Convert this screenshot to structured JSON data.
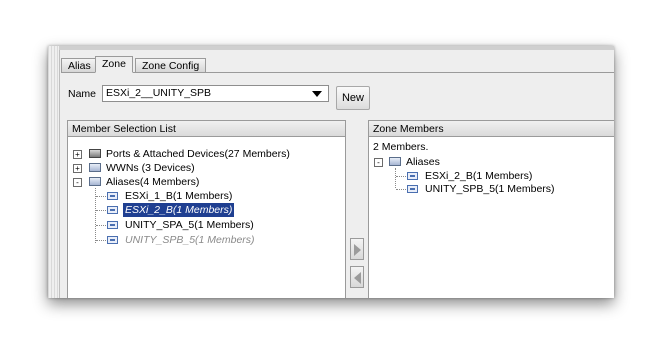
{
  "tabs": [
    {
      "label": "Alias",
      "active": false
    },
    {
      "label": "Zone",
      "active": true
    },
    {
      "label": "Zone Config",
      "active": false
    }
  ],
  "name_field": {
    "label": "Name",
    "value": "ESXi_2__UNITY_SPB"
  },
  "new_button": "New",
  "member_selection": {
    "title": "Member Selection List",
    "nodes": [
      {
        "label": "Ports & Attached Devices(27 Members)",
        "icon": "port-icon",
        "expander": "+"
      },
      {
        "label": "WWNs (3 Devices)",
        "icon": "wwn-icon",
        "expander": "+"
      },
      {
        "label": "Aliases(4 Members)",
        "icon": "folder-icon",
        "expander": "-"
      }
    ],
    "aliases": [
      {
        "label": "ESXi_1_B(1 Members)",
        "state": "normal"
      },
      {
        "label": "ESXi_2_B(1 Members)",
        "state": "selected"
      },
      {
        "label": "UNITY_SPA_5(1 Members)",
        "state": "normal"
      },
      {
        "label": "UNITY_SPB_5(1 Members)",
        "state": "disabled"
      }
    ]
  },
  "zone_members": {
    "title": "Zone Members",
    "count": "2 Members.",
    "folder": "Aliases",
    "folder_expander": "-",
    "items": [
      {
        "label": "ESXi_2_B(1 Members)"
      },
      {
        "label": "UNITY_SPB_5(1 Members)"
      }
    ]
  },
  "colors": {
    "selection": "#1f3f91",
    "panel_bg": "#eeeeee"
  }
}
